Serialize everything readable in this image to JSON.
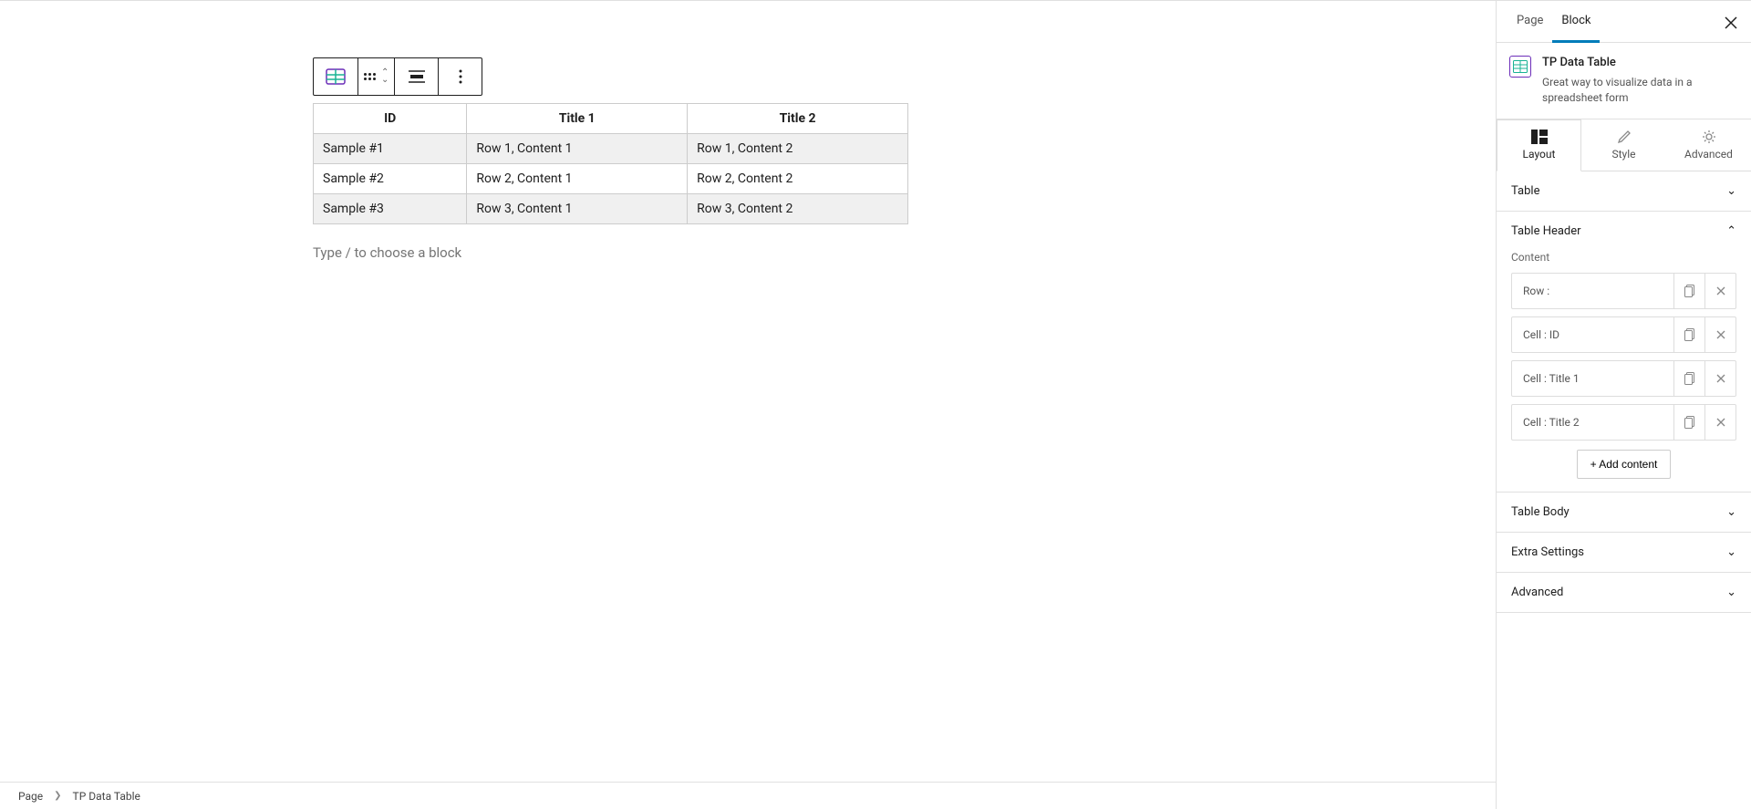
{
  "sidebar_tabs": {
    "page": "Page",
    "block": "Block"
  },
  "block_header": {
    "title": "TP Data Table",
    "description": "Great way to visualize data in a spreadsheet form"
  },
  "sub_tabs": {
    "layout": "Layout",
    "style": "Style",
    "advanced": "Advanced"
  },
  "panels": {
    "table": "Table",
    "table_header": "Table Header",
    "table_body": "Table Body",
    "extra_settings": "Extra Settings",
    "advanced": "Advanced"
  },
  "content_label": "Content",
  "content_items": [
    {
      "label": "Row :"
    },
    {
      "label": "Cell : ID"
    },
    {
      "label": "Cell : Title 1"
    },
    {
      "label": "Cell : Title 2"
    }
  ],
  "add_content": "+ Add content",
  "table": {
    "headers": [
      "ID",
      "Title 1",
      "Title 2"
    ],
    "rows": [
      [
        "Sample #1",
        "Row 1, Content 1",
        "Row 1, Content 2"
      ],
      [
        "Sample #2",
        "Row 2, Content 1",
        "Row 2, Content 2"
      ],
      [
        "Sample #3",
        "Row 3, Content 1",
        "Row 3, Content 2"
      ]
    ]
  },
  "placeholder": "Type / to choose a block",
  "breadcrumb": {
    "page": "Page",
    "block": "TP Data Table"
  }
}
